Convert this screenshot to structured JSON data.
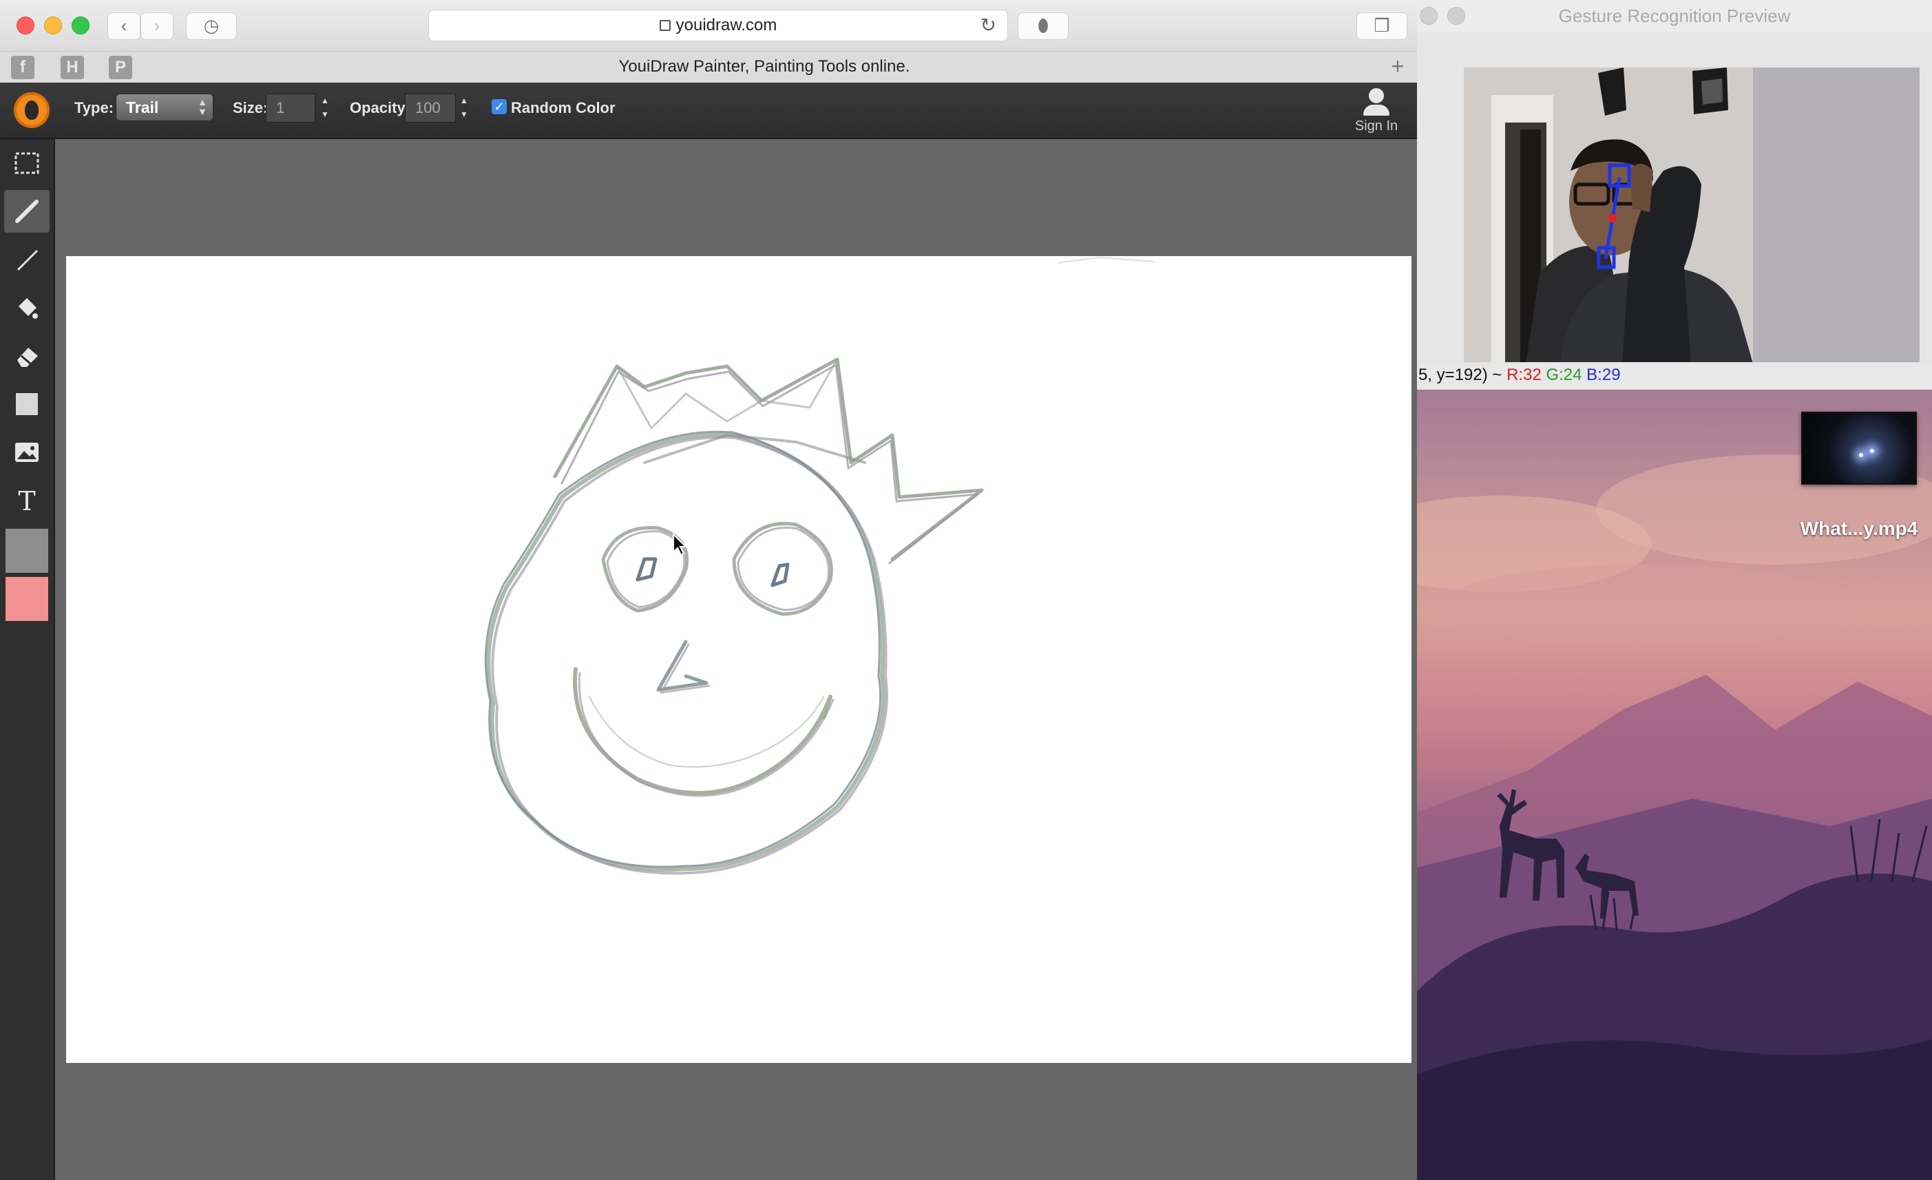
{
  "browser": {
    "url": "youidraw.com",
    "tab_title": "YouiDraw Painter, Painting Tools online.",
    "favorites": [
      "f",
      "H",
      "P"
    ]
  },
  "toolbar": {
    "type_label": "Type:",
    "type_value": "Trail",
    "size_label": "Size:",
    "size_value": "1",
    "opacity_label": "Opacity:",
    "opacity_value": "100",
    "random_color_label": "Random Color",
    "random_color_checked": true,
    "sign_in_label": "Sign In"
  },
  "tools": [
    {
      "icon": "rectangle-select-icon"
    },
    {
      "icon": "pencil-icon",
      "active": true
    },
    {
      "icon": "brush-icon"
    },
    {
      "icon": "paint-bucket-icon"
    },
    {
      "icon": "eraser-icon"
    },
    {
      "icon": "shape-icon"
    },
    {
      "icon": "image-icon"
    },
    {
      "icon": "text-icon"
    }
  ],
  "colors": {
    "foreground": "#8e8e8e",
    "background": "#f19191",
    "accent": "#f28a1c"
  },
  "preview": {
    "title": "Gesture Recognition Preview",
    "readout_prefix": "5, y=192) ~ ",
    "r": "R:32",
    "g": "G:24",
    "b": "B:29"
  },
  "desktop": {
    "video_label": "What...y.mp4"
  }
}
